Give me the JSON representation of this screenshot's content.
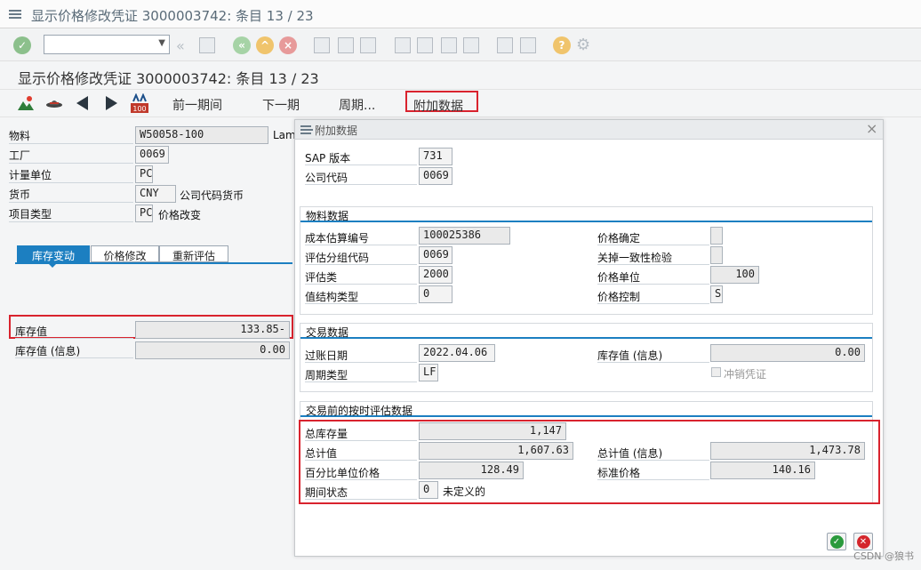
{
  "window": {
    "title": "显示价格修改凭证 3000003742: 条目 13 / 23"
  },
  "page": {
    "title": "显示价格修改凭证 3000003742: 条目 13 / 23"
  },
  "app_toolbar": {
    "prev_period": "前一期间",
    "next_period": "下一期",
    "period": "周期...",
    "additional_data": "附加数据"
  },
  "header_fields": {
    "material_label": "物料",
    "material_value": "W50058-100",
    "material_desc": "Lam",
    "plant_label": "工厂",
    "plant_value": "0069",
    "uom_label": "计量单位",
    "uom_value": "PC",
    "currency_label": "货币",
    "currency_value": "CNY",
    "currency_desc": "公司代码货币",
    "item_type_label": "项目类型",
    "item_type_value": "PC",
    "item_type_desc": "价格改变"
  },
  "tabs": [
    "库存变动",
    "价格修改",
    "重新评估"
  ],
  "stock_tab": {
    "stock_value_label": "库存值",
    "stock_value": "133.85-",
    "stock_value_info_label": "库存值 (信息)",
    "stock_value_info": "0.00"
  },
  "dialog": {
    "title": "附加数据",
    "sap_version_label": "SAP 版本",
    "sap_version": "731",
    "company_code_label": "公司代码",
    "company_code": "0069",
    "material_group": {
      "title": "物料数据",
      "cost_est_no_label": "成本估算编号",
      "cost_est_no": "100025386",
      "val_group_label": "评估分组代码",
      "val_group": "0069",
      "val_class_label": "评估类",
      "val_class": "2000",
      "val_struct_label": "值结构类型",
      "val_struct": "0",
      "price_det_label": "价格确定",
      "price_det": "",
      "consistency_label": "关掉一致性检验",
      "consistency": "",
      "price_unit_label": "价格单位",
      "price_unit": "100",
      "price_control_label": "价格控制",
      "price_control": "S"
    },
    "trans_group": {
      "title": "交易数据",
      "posting_date_label": "过账日期",
      "posting_date": "2022.04.06",
      "period_type_label": "周期类型",
      "period_type": "LF",
      "stock_info_label": "库存值 (信息)",
      "stock_info": "0.00",
      "reversal_label": "冲销凭证"
    },
    "val_group": {
      "title": "交易前的按时评估数据",
      "total_stock_label": "总库存量",
      "total_stock": "1,147",
      "total_value_label": "总计值",
      "total_value": "1,607.63",
      "total_value_info_label": "总计值 (信息)",
      "total_value_info": "1,473.78",
      "pct_price_label": "百分比单位价格",
      "pct_price": "128.49",
      "std_price_label": "标准价格",
      "std_price": "140.16",
      "period_status_label": "期间状态",
      "period_status": "0",
      "period_status_desc": "未定义的"
    }
  },
  "watermark": "CSDN @狼书",
  "colors": {
    "accent": "#1c7fc1",
    "highlight_box": "#d9232e",
    "ok_green": "#2a9a3c",
    "cancel_red": "#d4262c"
  }
}
